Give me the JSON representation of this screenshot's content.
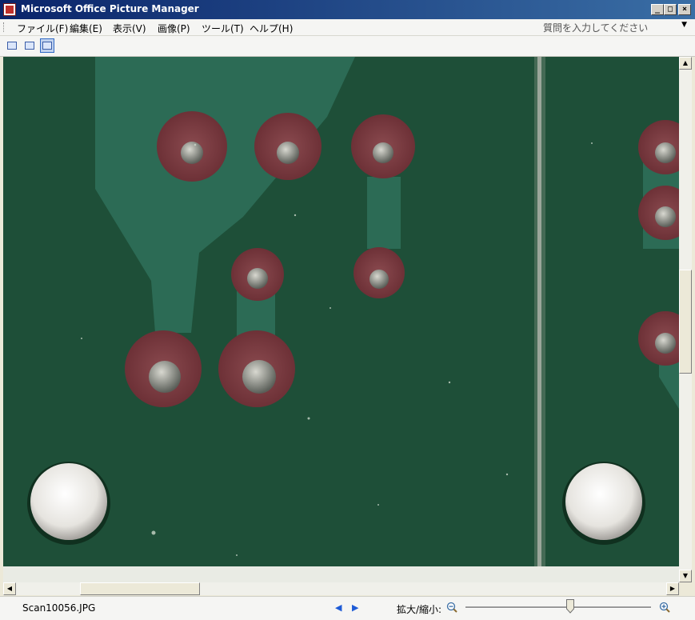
{
  "window": {
    "title": "Microsoft Office Picture Manager",
    "minimize": "_",
    "maximize": "□",
    "close": "×"
  },
  "menu": {
    "items": [
      "ファイル(F)",
      "編集(E)",
      "表示(V)",
      "画像(P)",
      "ツール(T)",
      "ヘルプ(H)"
    ],
    "help_placeholder": "質問を入力してください"
  },
  "toolbar": {
    "buttons": [
      "thumbnail-view-icon",
      "filmstrip-view-icon",
      "single-picture-view-icon"
    ],
    "active": 2
  },
  "status": {
    "filename": "Scan10056.JPG",
    "zoom_label": "拡大/縮小:",
    "prev_arrow": "◀",
    "next_arrow": "▶"
  },
  "scrollbars": {
    "vertical_position": 0.45,
    "horizontal_position": 0.05
  },
  "zoom": {
    "level": 0.56
  },
  "colors": {
    "pcb_green": "#1e4f38",
    "copper_pad": "#7a3a3e",
    "title_bar": "#0a246a",
    "accent": "#316ac5"
  }
}
